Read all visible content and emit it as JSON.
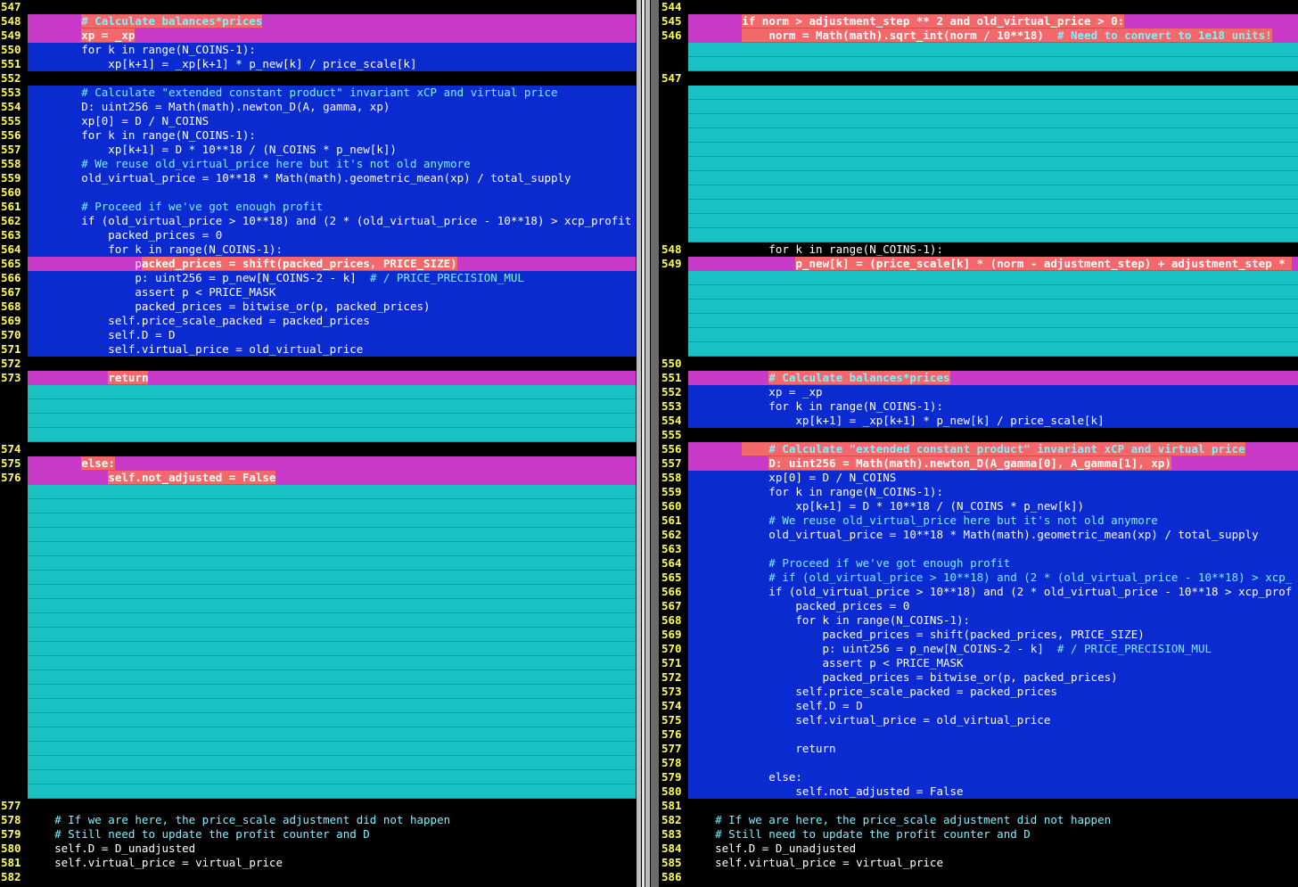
{
  "left_pane": {
    "rows": [
      {
        "ln": "547",
        "bg": "none",
        "segs": []
      },
      {
        "ln": "548",
        "bg": "magenta",
        "segs": [
          {
            "t": "        ",
            "c": "code"
          },
          {
            "t": "# Calculate balances*prices",
            "c": "comment",
            "hl": "salmon",
            "b": true
          }
        ]
      },
      {
        "ln": "549",
        "bg": "magenta",
        "segs": [
          {
            "t": "        ",
            "c": "code"
          },
          {
            "t": "xp = _xp",
            "c": "code",
            "hl": "salmon",
            "b": true
          }
        ]
      },
      {
        "ln": "550",
        "bg": "blue",
        "segs": [
          {
            "t": "        for k in range(N_COINS-1):",
            "c": "code"
          }
        ]
      },
      {
        "ln": "551",
        "bg": "blue",
        "segs": [
          {
            "t": "            xp[k+1] = _xp[k+1] * p_new[k] / price_scale[k]",
            "c": "code"
          }
        ]
      },
      {
        "ln": "552",
        "bg": "none",
        "segs": []
      },
      {
        "ln": "553",
        "bg": "blue",
        "segs": [
          {
            "t": "        # Calculate \"extended constant product\" invariant xCP and virtual price",
            "c": "comment"
          }
        ]
      },
      {
        "ln": "554",
        "bg": "blue",
        "segs": [
          {
            "t": "        D: uint256 = Math(math).newton_D(A, gamma, xp)",
            "c": "code"
          }
        ]
      },
      {
        "ln": "555",
        "bg": "blue",
        "segs": [
          {
            "t": "        xp[0] = D / N_COINS",
            "c": "code"
          }
        ]
      },
      {
        "ln": "556",
        "bg": "blue",
        "segs": [
          {
            "t": "        for k in range(N_COINS-1):",
            "c": "code"
          }
        ]
      },
      {
        "ln": "557",
        "bg": "blue",
        "segs": [
          {
            "t": "            xp[k+1] = D * 10**18 / (N_COINS * p_new[k])",
            "c": "code"
          }
        ]
      },
      {
        "ln": "558",
        "bg": "blue",
        "segs": [
          {
            "t": "        # We reuse old_virtual_price here but it's not old anymore",
            "c": "comment"
          }
        ]
      },
      {
        "ln": "559",
        "bg": "blue",
        "segs": [
          {
            "t": "        old_virtual_price = 10**18 * Math(math).geometric_mean(xp) / total_supply",
            "c": "code"
          }
        ]
      },
      {
        "ln": "560",
        "bg": "blue",
        "segs": []
      },
      {
        "ln": "561",
        "bg": "blue",
        "segs": [
          {
            "t": "        # Proceed if we've got enough profit",
            "c": "comment"
          }
        ]
      },
      {
        "ln": "562",
        "bg": "blue",
        "segs": [
          {
            "t": "        if (old_virtual_price > 10**18) and (2 * (old_virtual_price - 10**18) > xcp_profit",
            "c": "code"
          }
        ]
      },
      {
        "ln": "563",
        "bg": "blue",
        "segs": [
          {
            "t": "            packed_prices = 0",
            "c": "code"
          }
        ]
      },
      {
        "ln": "564",
        "bg": "blue",
        "segs": [
          {
            "t": "            for k in range(N_COINS-1):",
            "c": "code"
          }
        ]
      },
      {
        "ln": "565",
        "bg": "magenta",
        "segs": [
          {
            "t": "                p",
            "c": "code"
          },
          {
            "t": "acked_prices = shift(packed_prices, PRICE_SIZE)",
            "c": "code",
            "hl": "salmon",
            "b": true
          }
        ]
      },
      {
        "ln": "566",
        "bg": "blue",
        "segs": [
          {
            "t": "                p: uint256 = p_new[N_COINS-2 - k]  ",
            "c": "code"
          },
          {
            "t": "# / PRICE_PRECISION_MUL",
            "c": "comment"
          }
        ]
      },
      {
        "ln": "567",
        "bg": "blue",
        "segs": [
          {
            "t": "                assert p < PRICE_MASK",
            "c": "code"
          }
        ]
      },
      {
        "ln": "568",
        "bg": "blue",
        "segs": [
          {
            "t": "                packed_prices = bitwise_or(p, packed_prices)",
            "c": "code"
          }
        ]
      },
      {
        "ln": "569",
        "bg": "blue",
        "segs": [
          {
            "t": "            self.price_scale_packed = packed_prices",
            "c": "code"
          }
        ]
      },
      {
        "ln": "570",
        "bg": "blue",
        "segs": [
          {
            "t": "            self.D = D",
            "c": "code"
          }
        ]
      },
      {
        "ln": "571",
        "bg": "blue",
        "segs": [
          {
            "t": "            self.virtual_price = old_virtual_price",
            "c": "code"
          }
        ]
      },
      {
        "ln": "572",
        "bg": "none",
        "segs": []
      },
      {
        "ln": "573",
        "bg": "magenta",
        "segs": [
          {
            "t": "            ",
            "c": "code"
          },
          {
            "t": "return",
            "c": "code",
            "hl": "salmon",
            "b": true
          }
        ]
      },
      {
        "ln": "",
        "bg": "filler",
        "segs": []
      },
      {
        "ln": "",
        "bg": "filler",
        "segs": []
      },
      {
        "ln": "",
        "bg": "filler",
        "segs": []
      },
      {
        "ln": "",
        "bg": "filler",
        "segs": []
      },
      {
        "ln": "574",
        "bg": "none",
        "segs": []
      },
      {
        "ln": "575",
        "bg": "magenta",
        "segs": [
          {
            "t": "        ",
            "c": "code"
          },
          {
            "t": "else:",
            "c": "code",
            "hl": "salmon",
            "b": true
          }
        ]
      },
      {
        "ln": "576",
        "bg": "magenta",
        "segs": [
          {
            "t": "            ",
            "c": "code"
          },
          {
            "t": "self.not_adjusted = False",
            "c": "code",
            "hl": "salmon",
            "b": true
          }
        ]
      },
      {
        "ln": "",
        "bg": "filler",
        "segs": []
      },
      {
        "ln": "",
        "bg": "filler",
        "segs": []
      },
      {
        "ln": "",
        "bg": "filler",
        "segs": []
      },
      {
        "ln": "",
        "bg": "filler",
        "segs": []
      },
      {
        "ln": "",
        "bg": "filler",
        "segs": []
      },
      {
        "ln": "",
        "bg": "filler",
        "segs": []
      },
      {
        "ln": "",
        "bg": "filler",
        "segs": []
      },
      {
        "ln": "",
        "bg": "filler",
        "segs": []
      },
      {
        "ln": "",
        "bg": "filler",
        "segs": []
      },
      {
        "ln": "",
        "bg": "filler",
        "segs": []
      },
      {
        "ln": "",
        "bg": "filler",
        "segs": []
      },
      {
        "ln": "",
        "bg": "filler",
        "segs": []
      },
      {
        "ln": "",
        "bg": "filler",
        "segs": []
      },
      {
        "ln": "",
        "bg": "filler",
        "segs": []
      },
      {
        "ln": "",
        "bg": "filler",
        "segs": []
      },
      {
        "ln": "",
        "bg": "filler",
        "segs": []
      },
      {
        "ln": "",
        "bg": "filler",
        "segs": []
      },
      {
        "ln": "",
        "bg": "filler",
        "segs": []
      },
      {
        "ln": "",
        "bg": "filler",
        "segs": []
      },
      {
        "ln": "",
        "bg": "filler",
        "segs": []
      },
      {
        "ln": "",
        "bg": "filler",
        "segs": []
      },
      {
        "ln": "",
        "bg": "filler",
        "segs": []
      },
      {
        "ln": "577",
        "bg": "none",
        "segs": []
      },
      {
        "ln": "578",
        "bg": "none",
        "segs": [
          {
            "t": "    # If we are here, the price_scale adjustment did not happen",
            "c": "comment"
          }
        ]
      },
      {
        "ln": "579",
        "bg": "none",
        "segs": [
          {
            "t": "    # Still need to update the profit counter and D",
            "c": "comment"
          }
        ]
      },
      {
        "ln": "580",
        "bg": "none",
        "segs": [
          {
            "t": "    self.D = D_unadjusted",
            "c": "code"
          }
        ]
      },
      {
        "ln": "581",
        "bg": "none",
        "segs": [
          {
            "t": "    self.virtual_price = virtual_price",
            "c": "code"
          }
        ]
      },
      {
        "ln": "582",
        "bg": "none",
        "segs": []
      }
    ]
  },
  "right_pane": {
    "rows": [
      {
        "ln": "544",
        "bg": "none",
        "segs": []
      },
      {
        "ln": "545",
        "bg": "magenta",
        "segs": [
          {
            "t": "        ",
            "c": "code"
          },
          {
            "t": "if norm > adjustment_step ** 2 and old_virtual_price > 0:",
            "c": "code",
            "hl": "salmon",
            "b": true
          }
        ]
      },
      {
        "ln": "546",
        "bg": "magenta",
        "segs": [
          {
            "t": "        ",
            "c": "code"
          },
          {
            "t": "    norm = Math(math).sqrt_int(norm / 10**18)  ",
            "c": "code",
            "hl": "salmon",
            "b": true
          },
          {
            "t": "# Need to convert to 1e18 units!",
            "c": "comment",
            "hl": "salmon",
            "b": true
          }
        ]
      },
      {
        "ln": "",
        "bg": "filler",
        "segs": []
      },
      {
        "ln": "",
        "bg": "filler",
        "segs": []
      },
      {
        "ln": "547",
        "bg": "none",
        "segs": []
      },
      {
        "ln": "",
        "bg": "filler",
        "segs": []
      },
      {
        "ln": "",
        "bg": "filler",
        "segs": []
      },
      {
        "ln": "",
        "bg": "filler",
        "segs": []
      },
      {
        "ln": "",
        "bg": "filler",
        "segs": []
      },
      {
        "ln": "",
        "bg": "filler",
        "segs": []
      },
      {
        "ln": "",
        "bg": "filler",
        "segs": []
      },
      {
        "ln": "",
        "bg": "filler",
        "segs": []
      },
      {
        "ln": "",
        "bg": "filler",
        "segs": []
      },
      {
        "ln": "",
        "bg": "filler",
        "segs": []
      },
      {
        "ln": "",
        "bg": "filler",
        "segs": []
      },
      {
        "ln": "",
        "bg": "filler",
        "segs": []
      },
      {
        "ln": "548",
        "bg": "none",
        "segs": [
          {
            "t": "            for k in range(N_COINS-1):",
            "c": "code"
          }
        ]
      },
      {
        "ln": "549",
        "bg": "magenta",
        "segs": [
          {
            "t": "                ",
            "c": "code"
          },
          {
            "t": "p_new[k] = (price_scale[k] * (norm - adjustment_step) + adjustment_step * ",
            "c": "code",
            "hl": "salmon",
            "b": true
          }
        ]
      },
      {
        "ln": "",
        "bg": "filler",
        "segs": []
      },
      {
        "ln": "",
        "bg": "filler",
        "segs": []
      },
      {
        "ln": "",
        "bg": "filler",
        "segs": []
      },
      {
        "ln": "",
        "bg": "filler",
        "segs": []
      },
      {
        "ln": "",
        "bg": "filler",
        "segs": []
      },
      {
        "ln": "",
        "bg": "filler",
        "segs": []
      },
      {
        "ln": "550",
        "bg": "none",
        "segs": []
      },
      {
        "ln": "551",
        "bg": "magenta",
        "segs": [
          {
            "t": "            ",
            "c": "code"
          },
          {
            "t": "# Calculate balances*prices",
            "c": "comment",
            "hl": "salmon",
            "b": true
          }
        ]
      },
      {
        "ln": "552",
        "bg": "blue",
        "segs": [
          {
            "t": "            xp = _xp",
            "c": "code"
          }
        ]
      },
      {
        "ln": "553",
        "bg": "blue",
        "segs": [
          {
            "t": "            for k in range(N_COINS-1):",
            "c": "code"
          }
        ]
      },
      {
        "ln": "554",
        "bg": "blue",
        "segs": [
          {
            "t": "                xp[k+1] = _xp[k+1] * p_new[k] / price_scale[k]",
            "c": "code"
          }
        ]
      },
      {
        "ln": "555",
        "bg": "none",
        "segs": []
      },
      {
        "ln": "556",
        "bg": "magenta",
        "segs": [
          {
            "t": "        ",
            "c": "code"
          },
          {
            "t": "    # Calculate \"extended constant product\" invariant xCP and virtual price",
            "c": "comment",
            "hl": "salmon",
            "b": true
          }
        ]
      },
      {
        "ln": "557",
        "bg": "magenta",
        "segs": [
          {
            "t": "            ",
            "c": "code"
          },
          {
            "t": "D: uint256 = Math(math).newton_D(A_gamma[0], A_gamma[1], xp)",
            "c": "code",
            "hl": "salmon",
            "b": true
          }
        ]
      },
      {
        "ln": "558",
        "bg": "blue",
        "segs": [
          {
            "t": "            xp[0] = D / N_COINS",
            "c": "code"
          }
        ]
      },
      {
        "ln": "559",
        "bg": "blue",
        "segs": [
          {
            "t": "            for k in range(N_COINS-1):",
            "c": "code"
          }
        ]
      },
      {
        "ln": "560",
        "bg": "blue",
        "segs": [
          {
            "t": "                xp[k+1] = D * 10**18 / (N_COINS * p_new[k])",
            "c": "code"
          }
        ]
      },
      {
        "ln": "561",
        "bg": "blue",
        "segs": [
          {
            "t": "            # We reuse old_virtual_price here but it's not old anymore",
            "c": "comment"
          }
        ]
      },
      {
        "ln": "562",
        "bg": "blue",
        "segs": [
          {
            "t": "            old_virtual_price = 10**18 * Math(math).geometric_mean(xp) / total_supply",
            "c": "code"
          }
        ]
      },
      {
        "ln": "563",
        "bg": "blue",
        "segs": []
      },
      {
        "ln": "564",
        "bg": "blue",
        "segs": [
          {
            "t": "            # Proceed if we've got enough profit",
            "c": "comment"
          }
        ]
      },
      {
        "ln": "565",
        "bg": "blue",
        "segs": [
          {
            "t": "            # if (old_virtual_price > 10**18) and (2 * (old_virtual_price - 10**18) > xcp_",
            "c": "comment"
          }
        ]
      },
      {
        "ln": "566",
        "bg": "blue",
        "segs": [
          {
            "t": "            if (old_virtual_price > 10**18) and (2 * old_virtual_price - 10**18 > xcp_prof",
            "c": "code"
          }
        ]
      },
      {
        "ln": "567",
        "bg": "blue",
        "segs": [
          {
            "t": "                packed_prices = 0",
            "c": "code"
          }
        ]
      },
      {
        "ln": "568",
        "bg": "blue",
        "segs": [
          {
            "t": "                for k in range(N_COINS-1):",
            "c": "code"
          }
        ]
      },
      {
        "ln": "569",
        "bg": "blue",
        "segs": [
          {
            "t": "                    packed_prices = shift(packed_prices, PRICE_SIZE)",
            "c": "code"
          }
        ]
      },
      {
        "ln": "570",
        "bg": "blue",
        "segs": [
          {
            "t": "                    p: uint256 = p_new[N_COINS-2 - k]  ",
            "c": "code"
          },
          {
            "t": "# / PRICE_PRECISION_MUL",
            "c": "comment"
          }
        ]
      },
      {
        "ln": "571",
        "bg": "blue",
        "segs": [
          {
            "t": "                    assert p < PRICE_MASK",
            "c": "code"
          }
        ]
      },
      {
        "ln": "572",
        "bg": "blue",
        "segs": [
          {
            "t": "                    packed_prices = bitwise_or(p, packed_prices)",
            "c": "code"
          }
        ]
      },
      {
        "ln": "573",
        "bg": "blue",
        "segs": [
          {
            "t": "                self.price_scale_packed = packed_prices",
            "c": "code"
          }
        ]
      },
      {
        "ln": "574",
        "bg": "blue",
        "segs": [
          {
            "t": "                self.D = D",
            "c": "code"
          }
        ]
      },
      {
        "ln": "575",
        "bg": "blue",
        "segs": [
          {
            "t": "                self.virtual_price = old_virtual_price",
            "c": "code"
          }
        ]
      },
      {
        "ln": "576",
        "bg": "blue",
        "segs": []
      },
      {
        "ln": "577",
        "bg": "blue",
        "segs": [
          {
            "t": "                return",
            "c": "code"
          }
        ]
      },
      {
        "ln": "578",
        "bg": "blue",
        "segs": []
      },
      {
        "ln": "579",
        "bg": "blue",
        "segs": [
          {
            "t": "            else:",
            "c": "code"
          }
        ]
      },
      {
        "ln": "580",
        "bg": "blue",
        "segs": [
          {
            "t": "                self.not_adjusted = False",
            "c": "code"
          }
        ]
      },
      {
        "ln": "581",
        "bg": "none",
        "segs": []
      },
      {
        "ln": "582",
        "bg": "none",
        "segs": [
          {
            "t": "    # If we are here, the price_scale adjustment did not happen",
            "c": "comment"
          }
        ]
      },
      {
        "ln": "583",
        "bg": "none",
        "segs": [
          {
            "t": "    # Still need to update the profit counter and D",
            "c": "comment"
          }
        ]
      },
      {
        "ln": "584",
        "bg": "none",
        "segs": [
          {
            "t": "    self.D = D_unadjusted",
            "c": "code"
          }
        ]
      },
      {
        "ln": "585",
        "bg": "none",
        "segs": [
          {
            "t": "    self.virtual_price = virtual_price",
            "c": "code"
          }
        ]
      },
      {
        "ln": "586",
        "bg": "none",
        "segs": []
      }
    ]
  },
  "colors": {
    "background": "#000000",
    "line_number": "#ffff54",
    "changed_block": "#0a2bd0",
    "changed_line": "#c93ac9",
    "changed_text": "#f2686b",
    "filler": "#18c2c2",
    "comment_text": "#7ff0ff",
    "code_text": "#ffffff"
  }
}
